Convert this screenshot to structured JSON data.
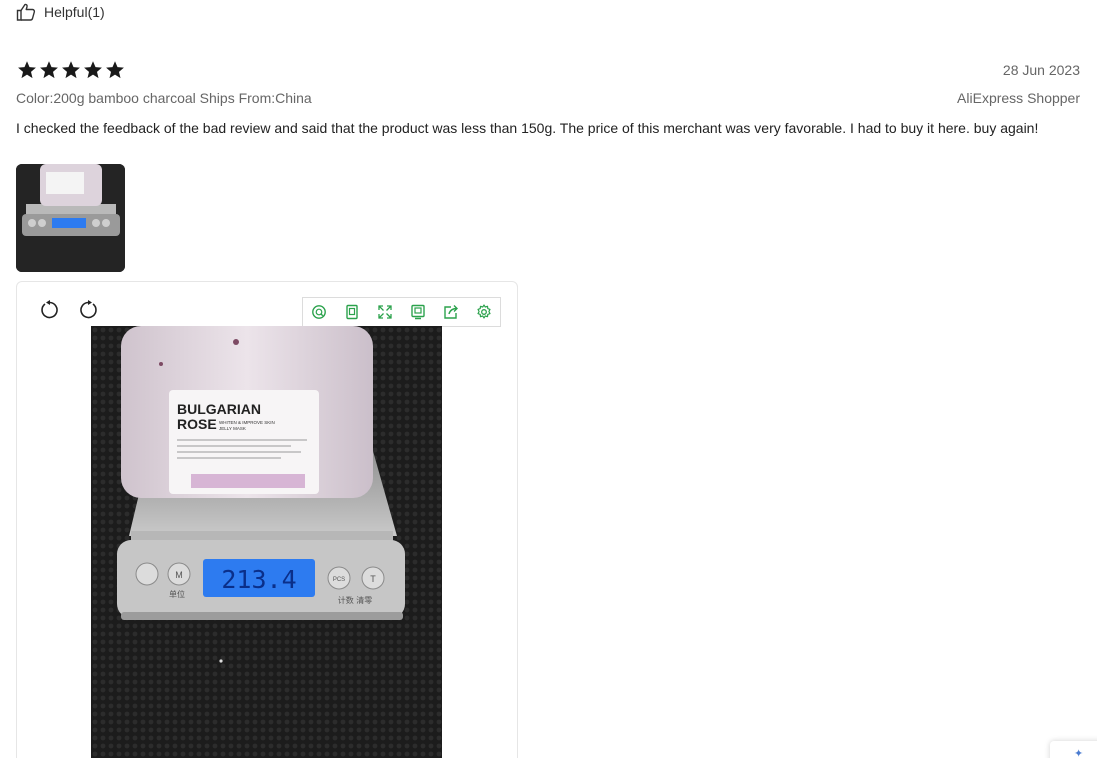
{
  "helpful": {
    "label": "Helpful(1)"
  },
  "review": {
    "rating": 5,
    "date": "28 Jun 2023",
    "meta": "Color:200g bamboo charcoal Ships From:China",
    "author": "AliExpress Shopper",
    "text": "I checked the feedback of the bad review and said that the product was less than 150g. The price of this merchant was very favorable. I had to buy it here. buy again!"
  },
  "photo": {
    "jar_label_line1": "BULGARIAN",
    "jar_label_line2": "ROSE",
    "jar_label_small": "WHITEN & IMPROVE SKIN",
    "jar_label_small2": "JELLY MASK",
    "scale_reading": "213.4",
    "scale_left_label": "单位",
    "scale_right_label": "计数  清零",
    "scale_btn_m": "M",
    "scale_btn_pcs": "PCS",
    "scale_btn_t": "T"
  },
  "viewer_tools": [
    "zoom-icon",
    "fit-icon",
    "fullscreen-icon",
    "save-icon",
    "share-icon",
    "settings-icon"
  ],
  "colors": {
    "star": "#191919",
    "tool_icon": "#2ba24c",
    "lcd": "#2d7bf0"
  }
}
